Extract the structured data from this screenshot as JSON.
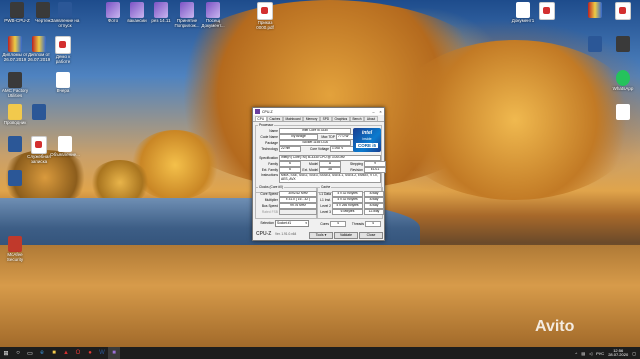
{
  "desktop": {
    "icons": [
      {
        "label": "PWB-CPU-Z",
        "kind": "app"
      },
      {
        "label": "Чертеж",
        "kind": "app"
      },
      {
        "label": "Заявление на отпуск",
        "kind": "word"
      },
      {
        "label": "Фото",
        "kind": "purple"
      },
      {
        "label": "вакансии",
        "kind": "purple"
      },
      {
        "label": "рез 14.11",
        "kind": "purple"
      },
      {
        "label": "Принятие Поприлож...",
        "kind": "purple"
      },
      {
        "label": "Посещ Документ...",
        "kind": "purple"
      },
      {
        "label": "Приказ 0000.pdf",
        "kind": "pdf"
      },
      {
        "label": "Документ1",
        "kind": "doc"
      },
      {
        "label": "",
        "kind": "pdf"
      },
      {
        "label": "",
        "kind": "winrar"
      },
      {
        "label": "",
        "kind": "pdf"
      },
      {
        "label": "Дипломы от 26.07.2019",
        "kind": "winrar"
      },
      {
        "label": "Диплом от 26.07.2019",
        "kind": "winrar"
      },
      {
        "label": "Демо к работе",
        "kind": "pdf"
      },
      {
        "label": "",
        "kind": "word"
      },
      {
        "label": "",
        "kind": "app"
      },
      {
        "label": "WhatsApp",
        "kind": "green"
      },
      {
        "label": "AMC Factory Utilities",
        "kind": "app"
      },
      {
        "label": "Вчера",
        "kind": "doc"
      },
      {
        "label": "Проводник",
        "kind": "folder"
      },
      {
        "label": "",
        "kind": "word"
      },
      {
        "label": "Служебная записка",
        "kind": "pdf"
      },
      {
        "label": "Объявление...",
        "kind": "doc"
      },
      {
        "label": "",
        "kind": "doc"
      },
      {
        "label": "",
        "kind": "word"
      },
      {
        "label": "McAfee Security",
        "kind": "red"
      },
      {
        "label": "",
        "kind": "app"
      }
    ]
  },
  "cpuz": {
    "title": "CPU-Z",
    "tabs": [
      "CPU",
      "Caches",
      "Mainboard",
      "Memory",
      "SPD",
      "Graphics",
      "Bench",
      "About"
    ],
    "processor_label": "Processor",
    "name_label": "Name",
    "name": "Intel Core i5 3330",
    "codename_label": "Code Name",
    "codename": "Ivy Bridge",
    "maxtdp_label": "Max TDP",
    "maxtdp": "77.0 W",
    "package_label": "Package",
    "package": "Socket 1155 LGA",
    "technology_label": "Technology",
    "technology": "22 nm",
    "corevoltage_label": "Core Voltage",
    "corevoltage": "1.092 V",
    "spec_label": "Specification",
    "spec": "Intel(R) Core(TM) i5-3330 CPU @ 3.00GHz",
    "family_label": "Family",
    "family": "6",
    "model_label": "Model",
    "model": "A",
    "stepping_label": "Stepping",
    "stepping": "9",
    "extfamily_label": "Ext. Family",
    "extfamily": "6",
    "extmodel_label": "Ext. Model",
    "extmodel": "3A",
    "revision_label": "Revision",
    "revision": "E1/L1",
    "instructions_label": "Instructions",
    "instructions": "MMX, SSE, SSE2, SSE3, SSSE3, SSE4.1, SSE4.2, EM64T, VT-x, AES, AVX",
    "clocks_label": "Clocks (Core #0)",
    "corespeed_label": "Core Speed",
    "corespeed": "3092.62 MHz",
    "multiplier_label": "Multiplier",
    "multiplier": "x 31.0 ( 16 - 32 )",
    "busspeed_label": "Bus Speed",
    "busspeed": "99.76 MHz",
    "ratedfsb_label": "Rated FSB",
    "ratedfsb": "",
    "cache_label": "Cache",
    "l1data_label": "L1 Data",
    "l1data": "4 x 32 KBytes",
    "l1data_way": "8-way",
    "l1inst_label": "L1 Inst.",
    "l1inst": "4 x 32 KBytes",
    "l1inst_way": "8-way",
    "level2_label": "Level 2",
    "level2": "4 x 256 KBytes",
    "level2_way": "8-way",
    "level3_label": "Level 3",
    "level3": "6 MBytes",
    "level3_way": "12-way",
    "selection_label": "Selection",
    "selection": "Socket #1",
    "cores_label": "Cores",
    "cores": "4",
    "threads_label": "Threads",
    "threads": "4",
    "version": "Ver. 1.91.0.x64",
    "tools_label": "Tools",
    "validate_label": "Validate",
    "close_label": "Close",
    "intel_brand": "intel",
    "intel_inside": "inside",
    "intel_core": "CORE i5"
  },
  "taskbar": {
    "lang": "РУС",
    "time": "12:56",
    "date": "28.07.2020"
  },
  "watermark": "Avito"
}
